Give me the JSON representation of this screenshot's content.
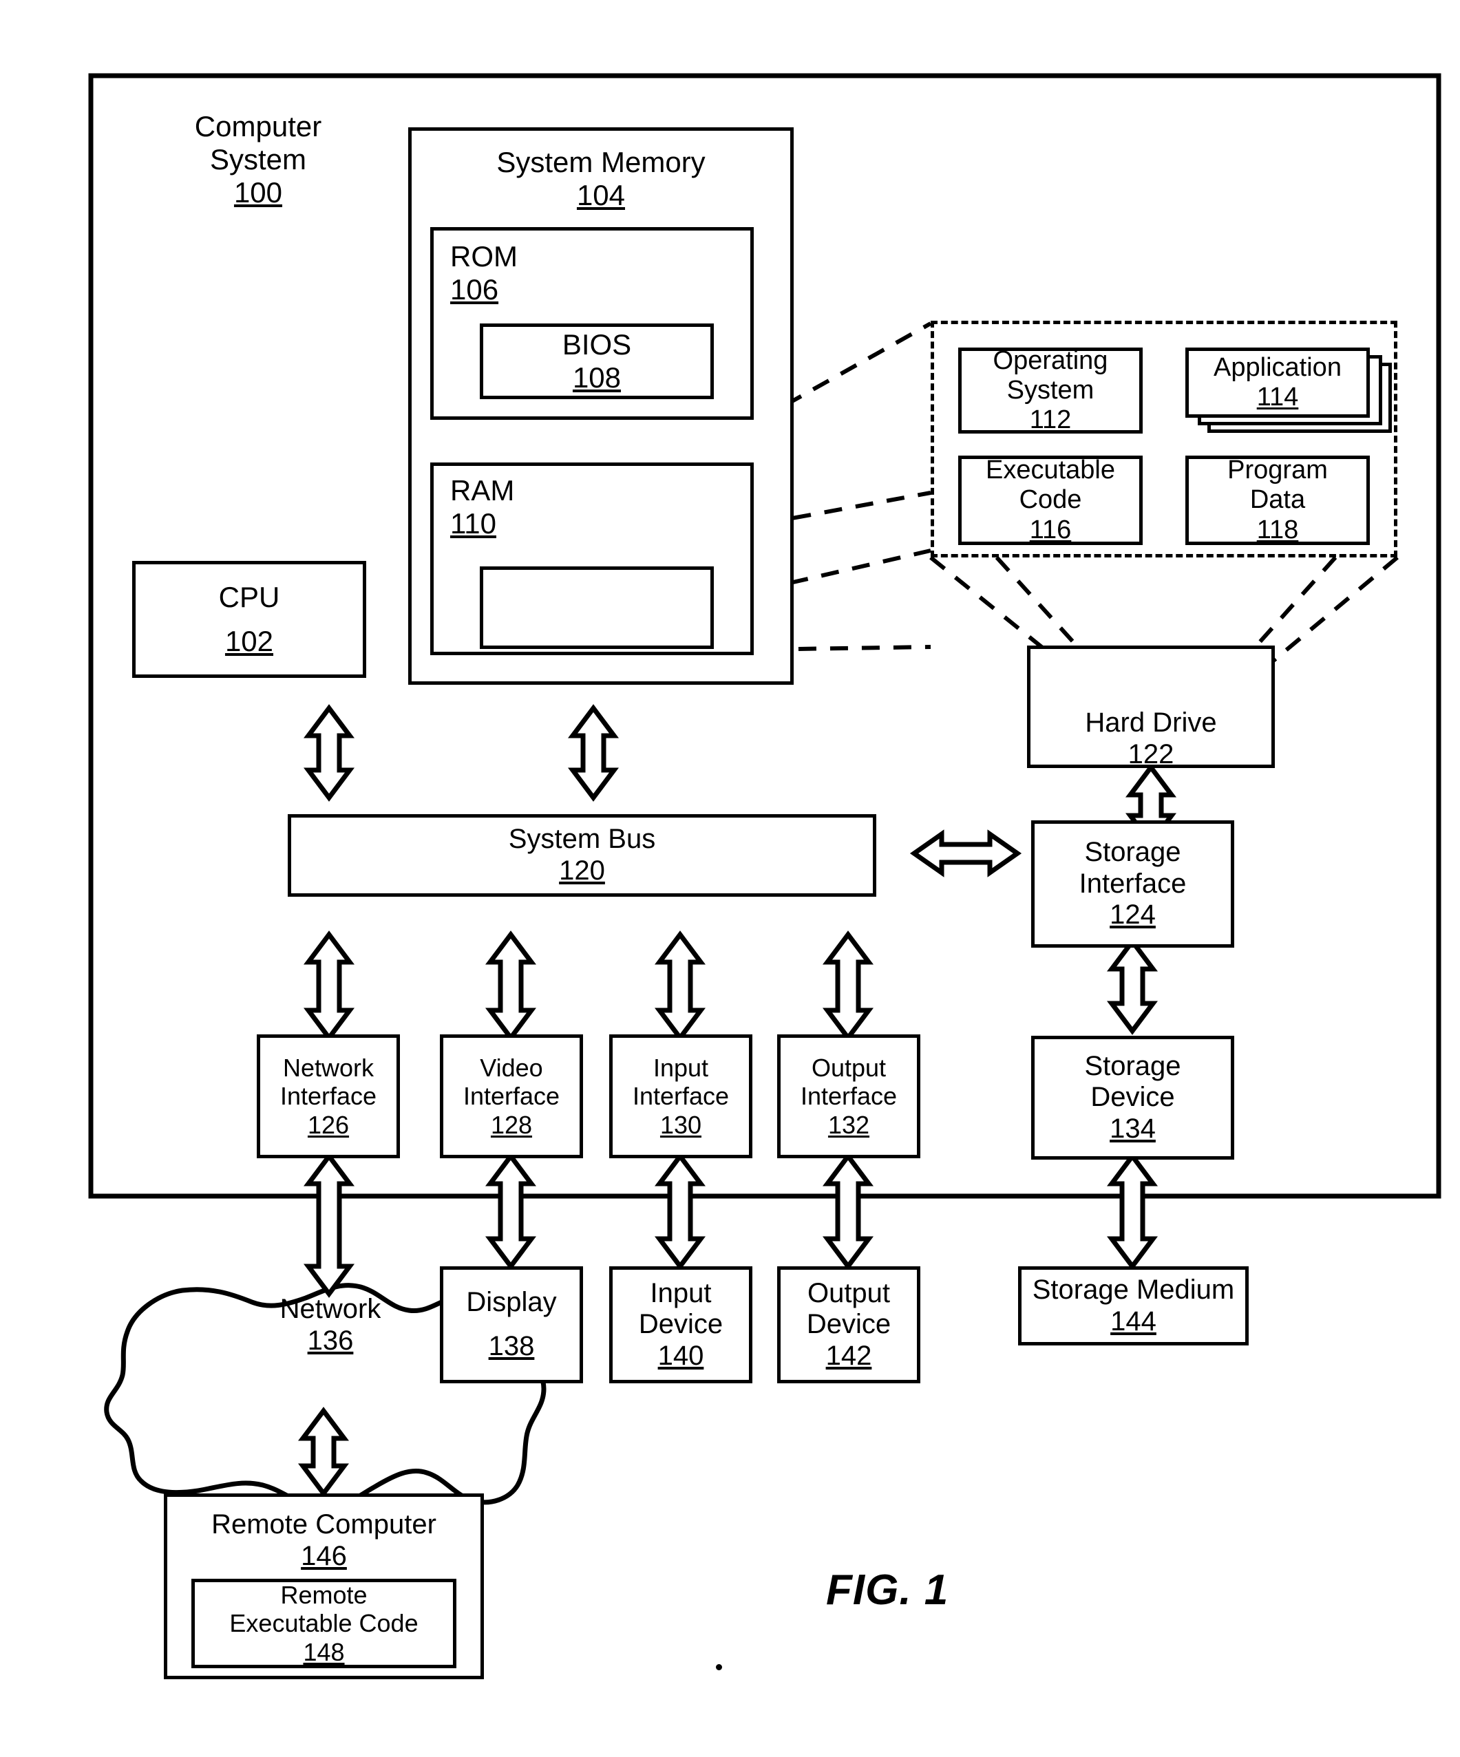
{
  "figure": {
    "label": "FIG. 1"
  },
  "outer": {
    "title": "Computer System",
    "number": "100"
  },
  "system_memory": {
    "title": "System Memory",
    "number": "104"
  },
  "rom": {
    "title": "ROM",
    "number": "106"
  },
  "bios": {
    "title": "BIOS",
    "number": "108"
  },
  "ram": {
    "title": "RAM",
    "number": "110"
  },
  "cpu": {
    "title": "CPU",
    "number": "102"
  },
  "dashed_group": {
    "operating_system": {
      "title": "Operating\nSystem",
      "number": "112"
    },
    "application": {
      "title": "Application",
      "number": "114"
    },
    "executable_code": {
      "title": "Executable\nCode",
      "number": "116"
    },
    "program_data": {
      "title": "Program\nData",
      "number": "118"
    }
  },
  "hard_drive": {
    "title": "Hard Drive",
    "number": "122"
  },
  "storage_interface": {
    "title": "Storage\nInterface",
    "number": "124"
  },
  "system_bus": {
    "title": "System Bus",
    "number": "120"
  },
  "interfaces": [
    {
      "title": "Network\nInterface",
      "number": "126"
    },
    {
      "title": "Video\nInterface",
      "number": "128"
    },
    {
      "title": "Input\nInterface",
      "number": "130"
    },
    {
      "title": "Output\nInterface",
      "number": "132"
    }
  ],
  "storage_device": {
    "title": "Storage\nDevice",
    "number": "134"
  },
  "peripherals": [
    {
      "title": "Display",
      "number": "138"
    },
    {
      "title": "Input\nDevice",
      "number": "140"
    },
    {
      "title": "Output\nDevice",
      "number": "142"
    }
  ],
  "network": {
    "title": "Network",
    "number": "136"
  },
  "storage_medium": {
    "title": "Storage Medium",
    "number": "144"
  },
  "remote_computer": {
    "title": "Remote Computer",
    "number": "146"
  },
  "remote_executable_code": {
    "title": "Remote\nExecutable Code",
    "number": "148"
  }
}
